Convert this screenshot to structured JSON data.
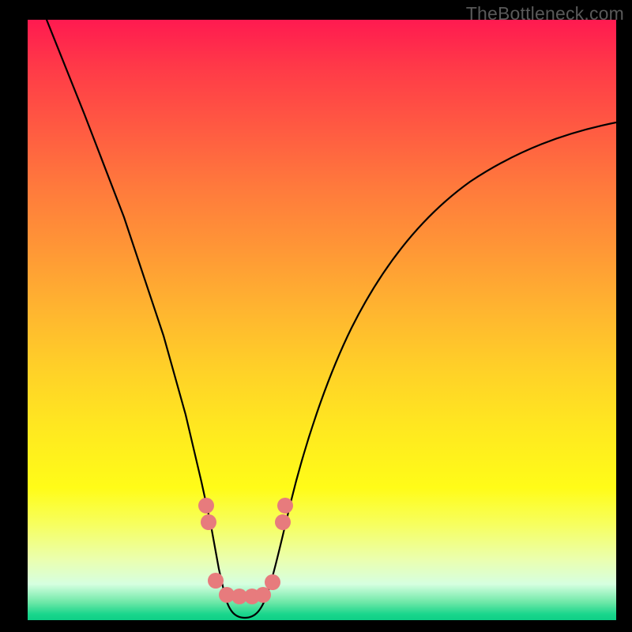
{
  "watermark": "TheBottleneck.com",
  "chart_data": {
    "type": "line",
    "title": "",
    "xlabel": "",
    "ylabel": "",
    "xlim": [
      0,
      100
    ],
    "ylim": [
      0,
      100
    ],
    "series": [
      {
        "name": "bottleneck-curve",
        "x": [
          3,
          6,
          9,
          12,
          15,
          18,
          21,
          24,
          27,
          30,
          33,
          36,
          38,
          40,
          45,
          50,
          55,
          60,
          65,
          70,
          75,
          80,
          85,
          90,
          95,
          100
        ],
        "values": [
          100,
          91,
          82,
          73,
          64,
          55,
          46,
          37,
          28,
          19,
          10,
          3,
          0,
          3,
          14,
          25,
          34,
          42,
          49,
          55,
          61,
          66,
          70,
          74,
          77,
          80
        ]
      }
    ],
    "markers": [
      {
        "x": 30,
        "y": 18
      },
      {
        "x": 30.5,
        "y": 14
      },
      {
        "x": 32,
        "y": 4
      },
      {
        "x": 34,
        "y": 3
      },
      {
        "x": 36,
        "y": 3
      },
      {
        "x": 38,
        "y": 3
      },
      {
        "x": 40,
        "y": 3
      },
      {
        "x": 42,
        "y": 4
      },
      {
        "x": 43.5,
        "y": 14
      },
      {
        "x": 44,
        "y": 18
      }
    ],
    "gradient_stops": [
      {
        "offset": 0,
        "color": "#ff1a50"
      },
      {
        "offset": 50,
        "color": "#ffd028"
      },
      {
        "offset": 80,
        "color": "#fffc18"
      },
      {
        "offset": 100,
        "color": "#0ecf86"
      }
    ]
  }
}
